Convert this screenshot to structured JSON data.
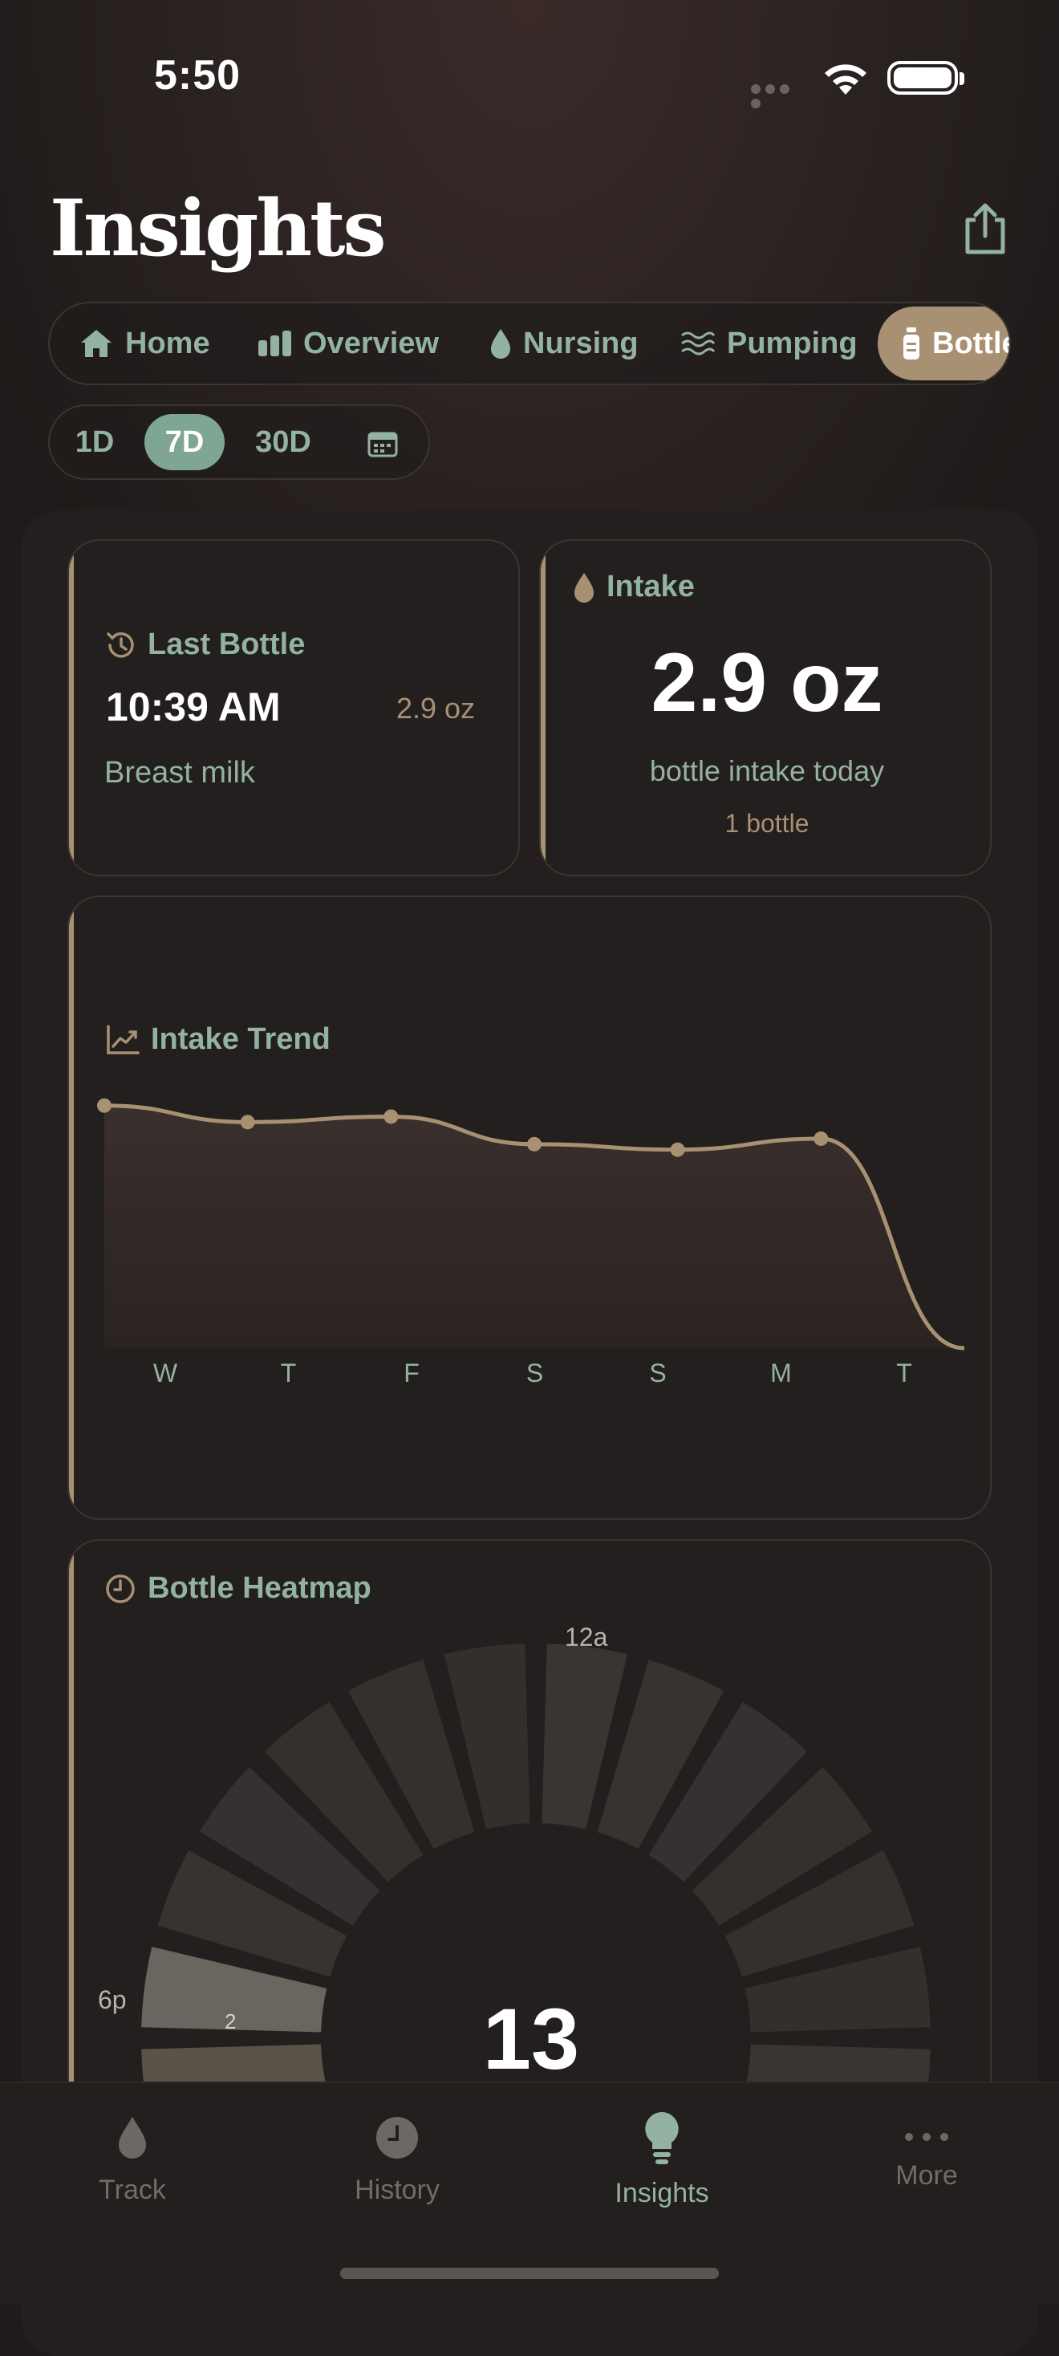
{
  "status": {
    "time": "5:50"
  },
  "header": {
    "title": "Insights"
  },
  "tabs": [
    {
      "label": "Home",
      "icon": "home-icon"
    },
    {
      "label": "Overview",
      "icon": "bars-icon"
    },
    {
      "label": "Nursing",
      "icon": "drop-icon"
    },
    {
      "label": "Pumping",
      "icon": "waves-icon"
    },
    {
      "label": "Bottle",
      "icon": "bottle-icon",
      "active": true
    }
  ],
  "ranges": [
    {
      "label": "1D"
    },
    {
      "label": "7D",
      "active": true
    },
    {
      "label": "30D"
    }
  ],
  "last_bottle": {
    "title": "Last Bottle",
    "time": "10:39 AM",
    "amount": "2.9 oz",
    "type": "Breast milk"
  },
  "intake": {
    "title": "Intake",
    "value": "2.9 oz",
    "caption": "bottle intake today",
    "count": "1 bottle"
  },
  "chart_data": {
    "type": "area",
    "title": "Intake Trend",
    "categories": [
      "W",
      "T",
      "F",
      "S",
      "S",
      "M",
      "T"
    ],
    "values": [
      4.4,
      4.1,
      4.2,
      3.7,
      3.6,
      3.8,
      0.0
    ],
    "ylim": [
      0,
      4.6
    ],
    "grid": false,
    "color": "#a89172"
  },
  "heatmap": {
    "title": "Bottle Heatmap",
    "label_top": "12a",
    "label_left": "6p",
    "center_value": "13",
    "highlight_count": "2"
  },
  "nav": [
    {
      "label": "Track",
      "icon": "drop-icon"
    },
    {
      "label": "History",
      "icon": "clock-icon"
    },
    {
      "label": "Insights",
      "icon": "lightbulb-icon",
      "active": true
    },
    {
      "label": "More",
      "icon": "ellipsis-icon"
    }
  ],
  "colors": {
    "accent": "#a89172",
    "sage": "#93b2a2",
    "active_range": "#7fa694"
  }
}
